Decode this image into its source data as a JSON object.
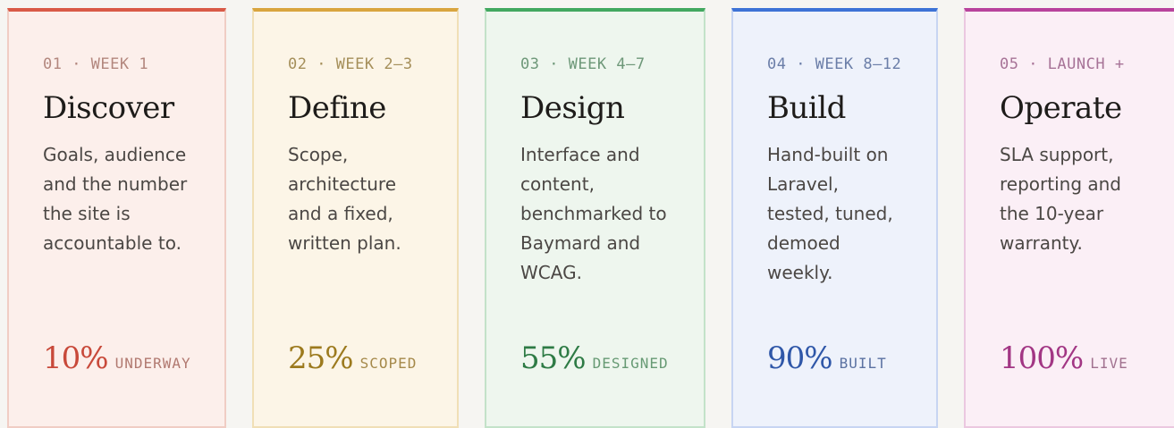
{
  "phases": [
    {
      "eyebrow": "01 · WEEK 1",
      "title": "Discover",
      "desc": "Goals, audience and the number the site is accountable to.",
      "pct": "10%",
      "status": "UNDERWAY",
      "colors": {
        "bg": "#fcefeb",
        "top": "#d95a47",
        "side": "#f0cdc4",
        "eyebrow": "#b3877e",
        "pct": "#c8493a",
        "status": "#b17970"
      }
    },
    {
      "eyebrow": "02 · WEEK 2–3",
      "title": "Define",
      "desc": "Scope, architecture and a fixed, written plan.",
      "pct": "25%",
      "status": "SCOPED",
      "colors": {
        "bg": "#fcf5e7",
        "top": "#d9a53f",
        "side": "#f0dfb6",
        "eyebrow": "#a58f5a",
        "pct": "#9c7a1e",
        "status": "#a5894a"
      }
    },
    {
      "eyebrow": "03 · WEEK 4–7",
      "title": "Design",
      "desc": "Interface and content, benchmarked to Baymard and WCAG.",
      "pct": "55%",
      "status": "DESIGNED",
      "colors": {
        "bg": "#eef6ee",
        "top": "#42a860",
        "side": "#c3e2c9",
        "eyebrow": "#6e9879",
        "pct": "#2e7b45",
        "status": "#679a74"
      }
    },
    {
      "eyebrow": "04 · WEEK 8–12",
      "title": "Build",
      "desc": "Hand-built on Laravel, tested, tuned, demoed weekly.",
      "pct": "90%",
      "status": "BUILT",
      "colors": {
        "bg": "#eef2fb",
        "top": "#3d72d6",
        "side": "#c7d5f2",
        "eyebrow": "#6b7ea8",
        "pct": "#2f57a8",
        "status": "#5b72a2"
      }
    },
    {
      "eyebrow": "05 · LAUNCH +",
      "title": "Operate",
      "desc": "SLA support, reporting and the 10-year warranty.",
      "pct": "100%",
      "status": "LIVE",
      "colors": {
        "bg": "#fbeff6",
        "top": "#b8439c",
        "side": "#ebc8e0",
        "eyebrow": "#a77397",
        "pct": "#a23684",
        "status": "#a1718f"
      }
    }
  ]
}
